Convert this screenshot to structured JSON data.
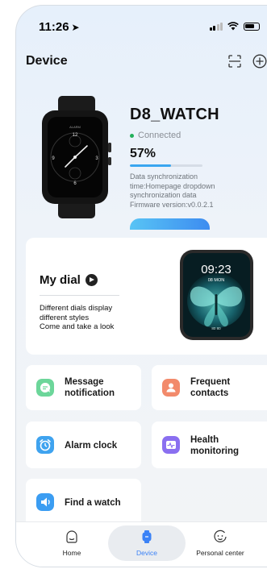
{
  "status_bar": {
    "time": "11:26"
  },
  "header": {
    "title": "Device"
  },
  "device": {
    "name": "D8_WATCH",
    "status": "Connected",
    "battery_percent": "57%",
    "battery_level": 0.57,
    "sync_lines": [
      "Data synchronization",
      "time:Homepage dropdown",
      "synchronization data"
    ],
    "firmware": "Firmware version:v0.0.2.1",
    "watch_face": {
      "top_label": "ALARM",
      "n12": "12",
      "n3": "3",
      "n6": "6",
      "n9": "9"
    }
  },
  "dial": {
    "title": "My dial",
    "desc_lines": [
      "Different dials display",
      "different styles",
      "Come and take a look"
    ],
    "preview_time": "09:23",
    "preview_date": "08 MON",
    "preview_small": "80  80"
  },
  "features": [
    {
      "label_lines": [
        "Message",
        "notification"
      ],
      "icon": "message-icon",
      "color": "#6cd69a"
    },
    {
      "label_lines": [
        "Frequent",
        "contacts"
      ],
      "icon": "contacts-icon",
      "color": "#f28a6b"
    },
    {
      "label_lines": [
        "Alarm clock"
      ],
      "icon": "alarm-clock-icon",
      "color": "#3fa3ef"
    },
    {
      "label_lines": [
        "Health",
        "monitoring"
      ],
      "icon": "health-icon",
      "color": "#8a6ff0"
    },
    {
      "label_lines": [
        "Find a watch"
      ],
      "icon": "find-watch-icon",
      "color": "#3b9df2"
    }
  ],
  "tabs": [
    {
      "label": "Home",
      "icon": "home-icon"
    },
    {
      "label": "Device",
      "icon": "watch-icon",
      "active": true,
      "color": "#3b82f6"
    },
    {
      "label": "Personal center",
      "icon": "smiley-icon"
    }
  ]
}
